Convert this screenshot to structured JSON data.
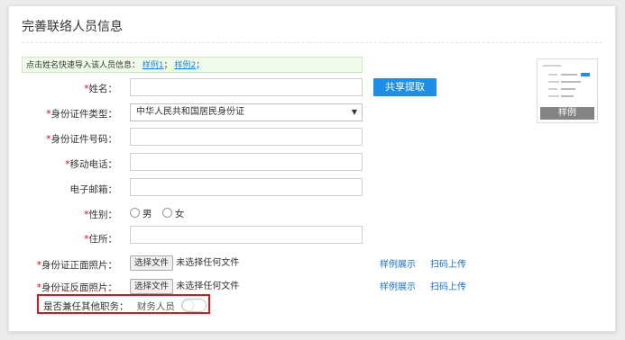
{
  "form": {
    "title": "完善联络人员信息",
    "hint": {
      "text": "点击姓名快速导入该人员信息：",
      "example1": "样例1",
      "sep": "；",
      "example2": "样例2",
      "end": "；"
    },
    "required_mark": "*",
    "fields": {
      "name": "姓名：",
      "id_type": "身份证件类型：",
      "id_type_value": "中华人民共和国居民身份证",
      "id_number": "身份证件号码：",
      "mobile": "移动电话：",
      "email": "电子邮箱：",
      "gender": "性别：",
      "gender_options": [
        "男",
        "女"
      ],
      "address": "住所：",
      "id_front": "身份证正面照片：",
      "id_back": "身份证反面照片：",
      "other_role": "是否兼任其他职务：",
      "role_option": "财务人员"
    },
    "share_button": "共享提取",
    "sample_caption": "样例",
    "file": {
      "choose": "选择文件",
      "none": "未选择任何文件",
      "sample_link": "样例展示",
      "scan_link": "扫码上传"
    },
    "toggle_on": false
  }
}
